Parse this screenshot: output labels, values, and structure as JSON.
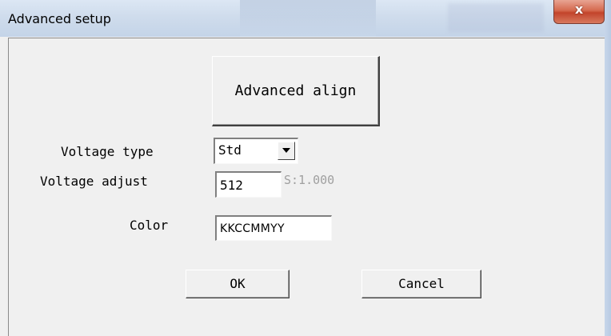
{
  "window": {
    "title": "Advanced setup",
    "close_glyph": "x"
  },
  "dialog": {
    "advanced_align_label": "Advanced align",
    "voltage_type": {
      "label": "Voltage type",
      "selected": "Std",
      "arrow_icon": "chevron-down-icon"
    },
    "voltage_adjust": {
      "label": "Voltage adjust",
      "value": "512",
      "hint": "S:1.000"
    },
    "color": {
      "label": "Color",
      "value": "KKCCMMYY"
    },
    "ok_label": "OK",
    "cancel_label": "Cancel"
  }
}
